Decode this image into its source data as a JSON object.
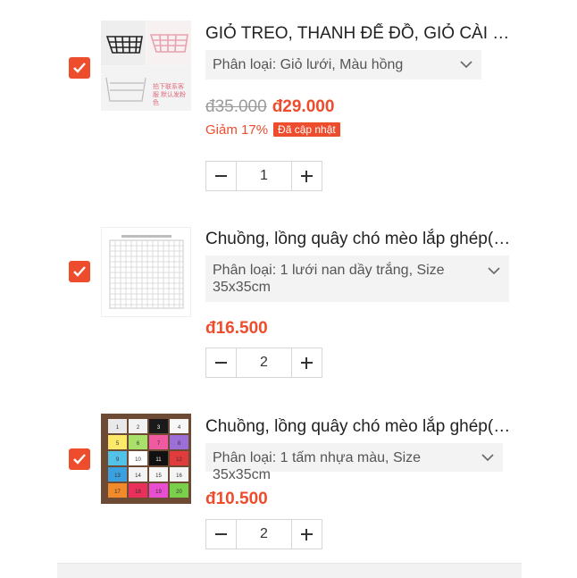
{
  "cart": {
    "items": [
      {
        "title": "GIỎ TREO, THANH ĐẾ ĐỒ, GIỎ CÀI ĐAI,...",
        "variant": "Phân loại: Giỏ lưới, Màu hồng",
        "old_price": "đ35.000",
        "price": "đ29.000",
        "discount": "Giảm 17%",
        "badge": "Đã cập nhật",
        "quantity": "1",
        "checked": true,
        "thumb_caption": "拍下联系客服 默认发粉色"
      },
      {
        "title": "Chuồng, lồng quây chó mèo lắp ghép( t...",
        "variant": "Phân loại: 1 lưới nan dầy trắng, Size 35x35cm",
        "price": "đ16.500",
        "quantity": "2",
        "checked": true
      },
      {
        "title": "Chuồng, lồng quây chó mèo lắp ghép( t...",
        "variant": "Phân loại: 1 tấm nhựa màu, Size 35x35cm",
        "price": "đ10.500",
        "quantity": "2",
        "checked": true,
        "tile_numbers": [
          "1",
          "2",
          "3",
          "4",
          "5",
          "6",
          "7",
          "8",
          "9",
          "10",
          "11",
          "12",
          "13",
          "14",
          "15",
          "16",
          "17",
          "18",
          "19",
          "20"
        ]
      }
    ]
  },
  "colors": {
    "accent": "#ee4d2d",
    "price": "#ee4d2d",
    "old_price": "#9a9a9a"
  },
  "icons": {
    "checkbox": "check-icon",
    "variant_toggle": "chevron-down-icon",
    "decrease": "minus-icon",
    "increase": "plus-icon"
  }
}
